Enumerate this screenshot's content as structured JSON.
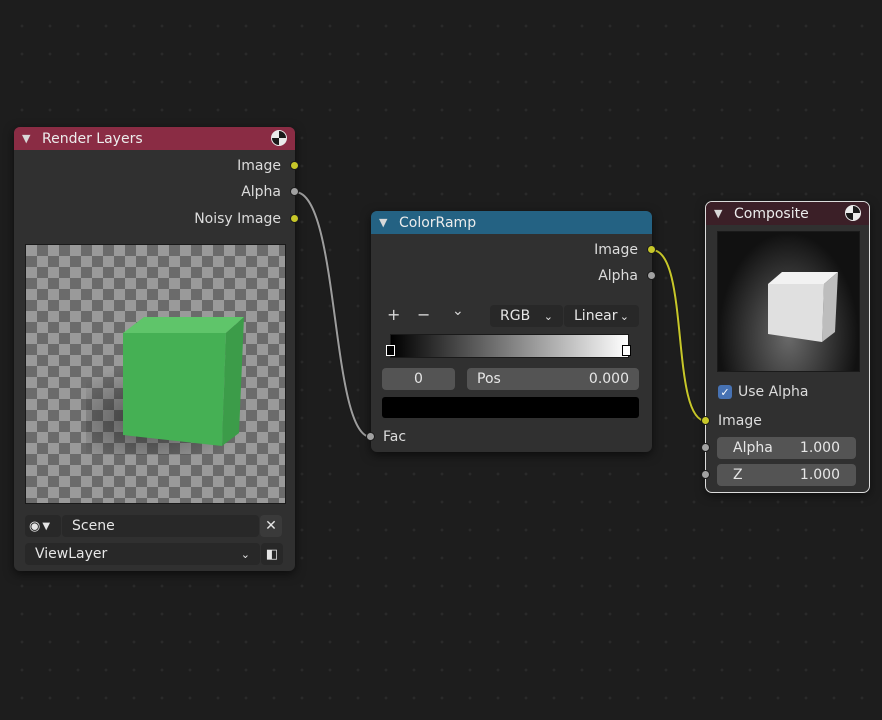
{
  "render_layers": {
    "title": "Render Layers",
    "outputs": [
      "Image",
      "Alpha",
      "Noisy Image"
    ],
    "scene": "Scene",
    "view_layer": "ViewLayer"
  },
  "color_ramp": {
    "title": "ColorRamp",
    "outputs": [
      "Image",
      "Alpha"
    ],
    "add": "+",
    "remove": "−",
    "menu": "⌄",
    "color_mode": "RGB",
    "interpolation": "Linear",
    "active_index": "0",
    "pos_label": "Pos",
    "pos_value": "0.000",
    "input": "Fac"
  },
  "composite": {
    "title": "Composite",
    "use_alpha_label": "Use Alpha",
    "image_label": "Image",
    "alpha_label": "Alpha",
    "alpha_value": "1.000",
    "z_label": "Z",
    "z_value": "1.000"
  },
  "colors": {
    "render_header": "#8a2c44",
    "colorramp_header": "#246283",
    "composite_header": "#3b1f27",
    "socket_yellow": "#c7c729",
    "socket_gray": "#a1a1a1"
  }
}
